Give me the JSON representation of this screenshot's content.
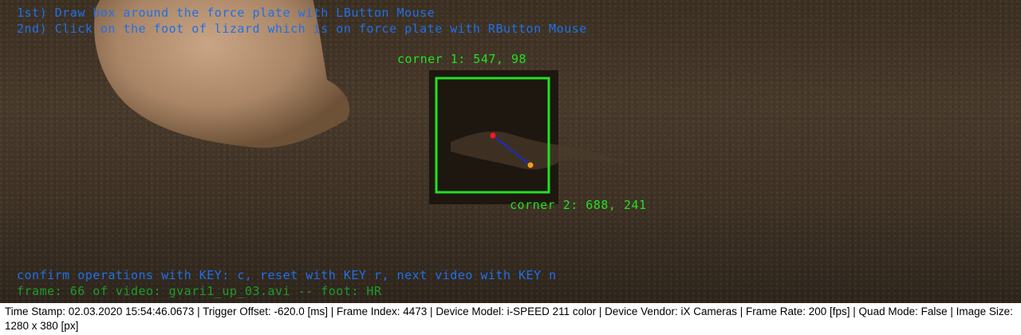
{
  "instructions": {
    "line1": "1st) Draw box around the force plate with LButton Mouse",
    "line2": "2nd) Click on the foot of lizard which is on force plate with RButton Mouse"
  },
  "selection": {
    "corner1_label": "corner 1: 547, 98",
    "corner2_label": "corner 2: 688, 241"
  },
  "footer_overlay": {
    "confirm_line": "confirm operations with KEY: c, reset with KEY r, next video with KEY n",
    "frame_line": "frame: 66 of video: gvari1_up_03.avi -- foot: HR"
  },
  "status_bar": {
    "text": "Time Stamp: 02.03.2020 15:54:46.0673  |  Trigger Offset: -620.0 [ms]  |  Frame Index: 4473  |  Device Model: i-SPEED 211 color  |  Device Vendor: iX Cameras  |  Frame Rate: 200 [fps]  |  Quad Mode: False  |  Image Size: 1280 x 380 [px]"
  },
  "colors": {
    "instruction_text": "#1f70e8",
    "box_and_labels": "#22e022",
    "foot_point": "#ff1a1a",
    "second_point": "#ff9a1a",
    "connector_line": "#1a2cc8"
  }
}
